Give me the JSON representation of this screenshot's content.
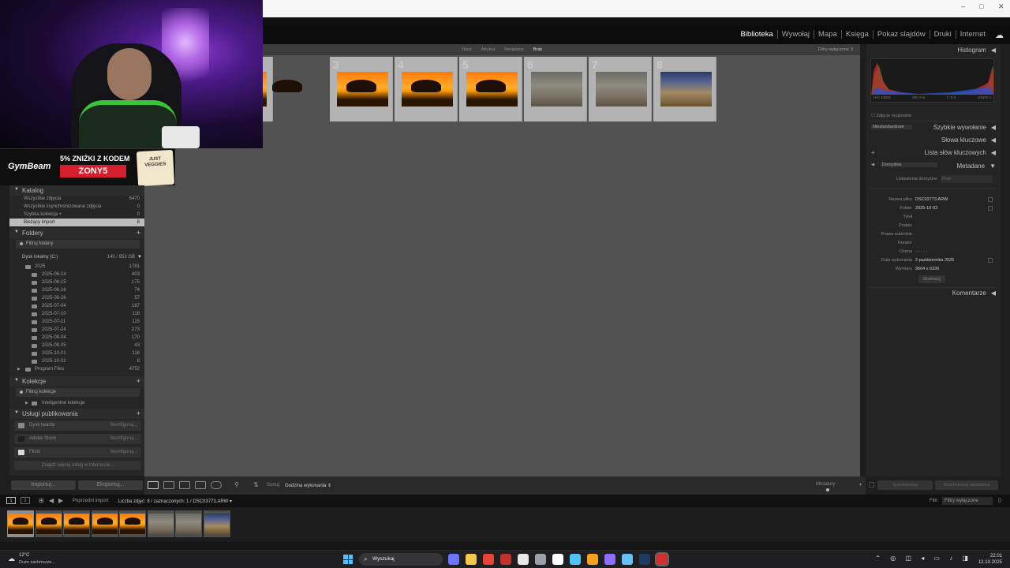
{
  "window": {
    "controls": [
      "–",
      "□",
      "✕"
    ]
  },
  "modules": {
    "items": [
      "Biblioteka",
      "Wywołaj",
      "Mapa",
      "Księga",
      "Pokaz slajdów",
      "Druki",
      "Internet"
    ],
    "active_index": 0
  },
  "promo": {
    "brand": "GymBeam",
    "discount": "5% ZNIŻKI Z KODEM",
    "code": "ZONY5",
    "pack_text": "JUST VEGGIES"
  },
  "left": {
    "catalog": {
      "title": "Katalog",
      "rows": [
        {
          "label": "Wszystkie zdjęcia",
          "count": "6470"
        },
        {
          "label": "Wszystkie zsynchronizowane zdjęcia",
          "count": "0"
        },
        {
          "label": "Szybka kolekcja +",
          "count": "0"
        },
        {
          "label": "Bieżący import",
          "count": "8"
        }
      ]
    },
    "folders": {
      "title": "Foldery",
      "filter": "Filtruj foldery",
      "disk": {
        "label": "Dysk lokalny (C:)",
        "space": "140 / 953 GB"
      },
      "year": {
        "label": "2025",
        "count": "1781"
      },
      "items": [
        {
          "label": "2025-06-14",
          "count": "403"
        },
        {
          "label": "2025-06-15",
          "count": "175"
        },
        {
          "label": "2025-06-16",
          "count": "74"
        },
        {
          "label": "2025-06-26",
          "count": "57"
        },
        {
          "label": "2025-07-04",
          "count": "187"
        },
        {
          "label": "2025-07-10",
          "count": "118"
        },
        {
          "label": "2025-07-11",
          "count": "115"
        },
        {
          "label": "2025-07-24",
          "count": "273"
        },
        {
          "label": "2025-09-04",
          "count": "170"
        },
        {
          "label": "2025-09-05",
          "count": "43"
        },
        {
          "label": "2025-10-01",
          "count": "118"
        },
        {
          "label": "2025-10-02",
          "count": "8"
        }
      ],
      "other": {
        "label": "Program Files",
        "count": "4752"
      }
    },
    "collections": {
      "title": "Kolekcje",
      "filter": "Filtruj kolekcje",
      "smart": "Inteligentne kolekcje"
    },
    "publish": {
      "title": "Usługi publikowania",
      "services": [
        {
          "label": "Dysk twardy",
          "action": "Skonfiguruj...",
          "color": "#8a8a8a"
        },
        {
          "label": "Adobe Stock",
          "action": "Skonfiguruj...",
          "color": "#1d1d1d"
        },
        {
          "label": "Flickr",
          "action": "Skonfiguruj...",
          "color": "#d9d9d9"
        }
      ],
      "find_more": "Znajdź więcej usług w Internecie..."
    },
    "import_btn": "Importuj...",
    "export_btn": "Eksportuj..."
  },
  "filterbar": {
    "items": [
      "Tekst",
      "Atrybut",
      "Metadane",
      "Brak"
    ],
    "active_index": 3,
    "right": "Filtry wyłączone ⇕"
  },
  "grid": {
    "cells": [
      {
        "num": "",
        "kind": "sunset"
      },
      {
        "num": "3",
        "kind": "sunset"
      },
      {
        "num": "4",
        "kind": "sunset"
      },
      {
        "num": "5",
        "kind": "sunset"
      },
      {
        "num": "6",
        "kind": "savanna"
      },
      {
        "num": "7",
        "kind": "savanna"
      },
      {
        "num": "8",
        "kind": "plain"
      }
    ]
  },
  "toolbar": {
    "sort_label": "Sortuj:",
    "sort_value": "Godzina wykonania ⇕",
    "thumb_label": "Miniatury"
  },
  "right": {
    "histogram": {
      "title": "Histogram",
      "iso": "ISO 10000",
      "focal": "400 mm",
      "aperture": "f / 5.0",
      "shutter": "1/6400 s",
      "original": "Zdjęcie oryginalne"
    },
    "quick_develop": {
      "preset": "Niestandardowe",
      "title": "Szybkie wywołanie"
    },
    "keywords": {
      "title": "Słowa kluczowe"
    },
    "keyword_list": {
      "title": "Lista słów kluczowych"
    },
    "metadata": {
      "preset": "Domyślne",
      "title": "Metadane",
      "defaults_label": "Ustawienia domyślne",
      "defaults_value": "Brak",
      "rows": [
        {
          "k": "Nazwa pliku",
          "v": "DSC03773.ARW"
        },
        {
          "k": "Folder",
          "v": "2025-10-02"
        },
        {
          "k": "Tytuł",
          "v": ""
        },
        {
          "k": "Podpis",
          "v": ""
        },
        {
          "k": "Prawa autorskie",
          "v": ""
        },
        {
          "k": "Kreator",
          "v": ""
        },
        {
          "k": "Ocena",
          "v": "· · · · ·"
        },
        {
          "k": "Data wykonania",
          "v": "2 października 2025"
        },
        {
          "k": "Wymiary",
          "v": "9504 x 6336"
        }
      ],
      "custom_btn": "Dostosuj"
    },
    "comments": {
      "title": "Komentarze"
    },
    "sync_meta": "Synchronizuj",
    "sync_settings": "Synchronizuj ustawienia"
  },
  "filmstrip": {
    "pages": [
      "1",
      "2"
    ],
    "source": "Poprzedni import",
    "count": "Liczba zdjęć: 8 / zaznaczonych: 1 / DSC03773.ARW ▾",
    "filter_label": "Filtr:",
    "filter_value": "Filtry wyłączone",
    "thumbs": [
      "sunset",
      "sunset",
      "sunset",
      "sunset",
      "sunset",
      "savanna",
      "savanna",
      "plain"
    ],
    "selected_index": 0
  },
  "taskbar": {
    "temp": "12°C",
    "condition": "Duże zachmurze...",
    "search": "Wyszukaj",
    "time": "22:01",
    "date": "12.10.2025",
    "apps": [
      "#6b74ff",
      "#f2c94c",
      "#ea4335",
      "#c4302b",
      "#e8e8e8",
      "#9aa0a6",
      "#ffffff",
      "#4fc3f7",
      "#f7a21b",
      "#8e6cff",
      "#66c0f4",
      "#1e3a5f",
      "#d32f2f"
    ]
  }
}
